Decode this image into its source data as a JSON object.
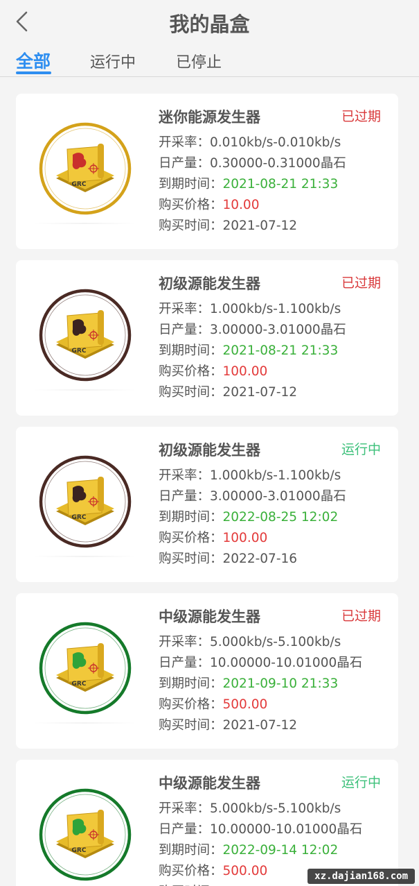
{
  "header": {
    "title": "我的晶盒"
  },
  "tabs": [
    {
      "label": "全部",
      "active": true
    },
    {
      "label": "运行中",
      "active": false
    },
    {
      "label": "已停止",
      "active": false
    }
  ],
  "field_labels": {
    "rate": "开采率：",
    "daily": "日产量：",
    "expire": "到期时间：",
    "price": "购买价格：",
    "purchase": "购买时间："
  },
  "cards": [
    {
      "name": "迷你能源发生器",
      "status": "已过期",
      "status_color": "#d9383a",
      "rate": "0.010kb/s-0.010kb/s",
      "daily": "0.30000-0.31000晶石",
      "expire": "2021-08-21 21:33",
      "price": "10.00",
      "purchase": "2021-07-12",
      "ring_color": "#d4a21a",
      "map_color": "#c9302c",
      "icon": "grc-mini-generator-icon"
    },
    {
      "name": "初级源能发生器",
      "status": "已过期",
      "status_color": "#d9383a",
      "rate": "1.000kb/s-1.100kb/s",
      "daily": "3.00000-3.01000晶石",
      "expire": "2021-08-21 21:33",
      "price": "100.00",
      "purchase": "2021-07-12",
      "ring_color": "#4a2a24",
      "map_color": "#3b2320",
      "icon": "grc-basic-generator-icon"
    },
    {
      "name": "初级源能发生器",
      "status": "运行中",
      "status_color": "#3cc07a",
      "rate": "1.000kb/s-1.100kb/s",
      "daily": "3.00000-3.01000晶石",
      "expire": "2022-08-25 12:02",
      "price": "100.00",
      "purchase": "2022-07-16",
      "ring_color": "#4a2a24",
      "map_color": "#3b2320",
      "icon": "grc-basic-generator-icon"
    },
    {
      "name": "中级源能发生器",
      "status": "已过期",
      "status_color": "#d9383a",
      "rate": "5.000kb/s-5.100kb/s",
      "daily": "10.00000-10.01000晶石",
      "expire": "2021-09-10 21:33",
      "price": "500.00",
      "purchase": "2021-07-12",
      "ring_color": "#157a2a",
      "map_color": "#2fa33a",
      "icon": "grc-intermediate-generator-icon"
    },
    {
      "name": "中级源能发生器",
      "status": "运行中",
      "status_color": "#3cc07a",
      "rate": "5.000kb/s-5.100kb/s",
      "daily": "10.00000-10.01000晶石",
      "expire": "2022-09-14 12:02",
      "price": "500.00",
      "purchase": "",
      "ring_color": "#157a2a",
      "map_color": "#2fa33a",
      "icon": "grc-intermediate-generator-icon"
    }
  ],
  "badge_text": "GRC",
  "watermark": "xz.dajian168.com"
}
